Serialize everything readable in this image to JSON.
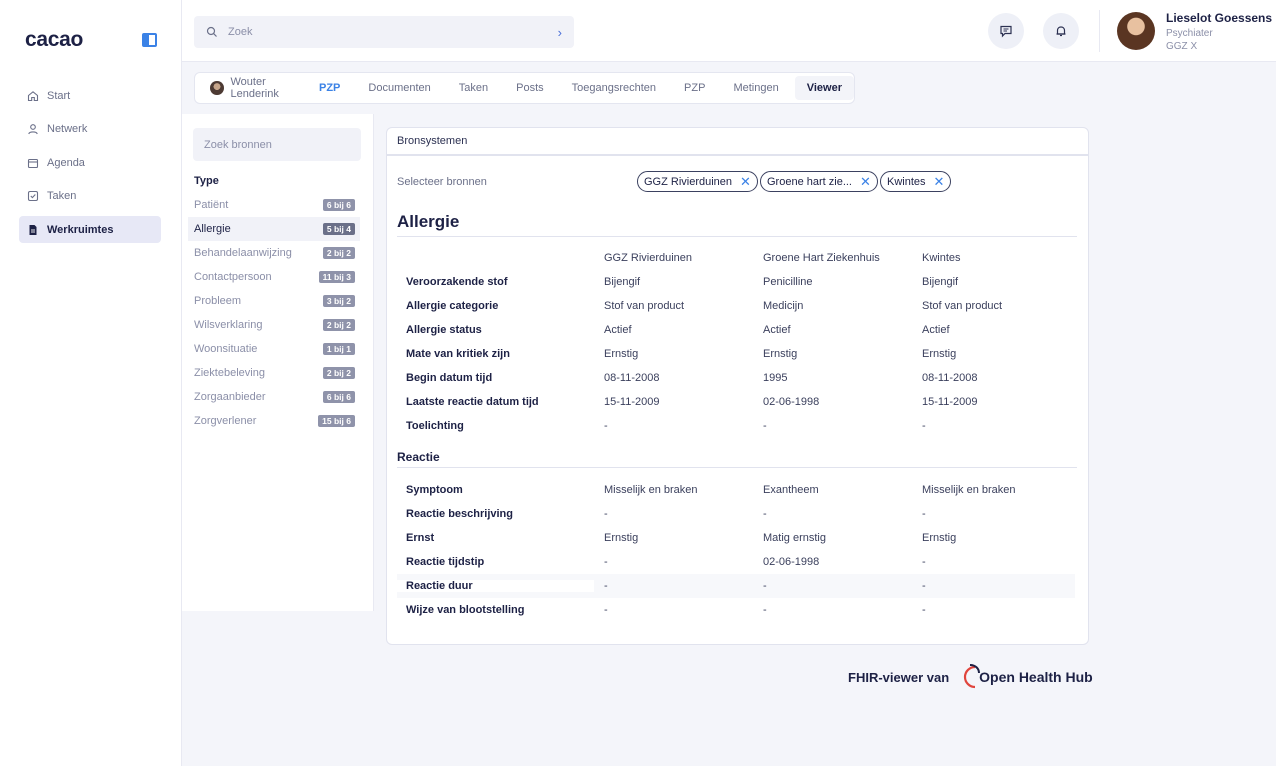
{
  "app": {
    "logo": "cacao"
  },
  "sidebar": {
    "items": [
      {
        "label": "Start",
        "icon": "home-icon"
      },
      {
        "label": "Netwerk",
        "icon": "user-icon"
      },
      {
        "label": "Agenda",
        "icon": "calendar-icon"
      },
      {
        "label": "Taken",
        "icon": "check-square-icon"
      },
      {
        "label": "Werkruimtes",
        "icon": "document-icon",
        "active": true
      }
    ]
  },
  "header": {
    "search_placeholder": "Zoek",
    "user": {
      "name": "Lieselot Goessens",
      "role": "Psychiater",
      "org": "GGZ X"
    }
  },
  "tabs": {
    "person": "Wouter Lenderink",
    "person_badge": "PZP",
    "items": [
      "Documenten",
      "Taken",
      "Posts",
      "Toegangsrechten",
      "PZP",
      "Metingen"
    ],
    "active": "Viewer"
  },
  "filter": {
    "search_placeholder": "Zoek bronnen",
    "type_heading": "Type",
    "types": [
      {
        "label": "Patiënt",
        "count": "6 bij 6"
      },
      {
        "label": "Allergie",
        "count": "5 bij 4",
        "active": true
      },
      {
        "label": "Behandelaanwijzing",
        "count": "2 bij 2"
      },
      {
        "label": "Contactpersoon",
        "count": "11 bij 3"
      },
      {
        "label": "Probleem",
        "count": "3 bij 2"
      },
      {
        "label": "Wilsverklaring",
        "count": "2 bij 2"
      },
      {
        "label": "Woonsituatie",
        "count": "1 bij 1"
      },
      {
        "label": "Ziektebeleving",
        "count": "2 bij 2"
      },
      {
        "label": "Zorgaanbieder",
        "count": "6 bij 6"
      },
      {
        "label": "Zorgverlener",
        "count": "15 bij 6"
      }
    ]
  },
  "viewer": {
    "card_title": "Bronsystemen",
    "select_label": "Selecteer bronnen",
    "chips": [
      "GGZ Rivierduinen",
      "Groene hart zie...",
      "Kwintes"
    ],
    "section_title": "Allergie",
    "columns": [
      "GGZ Rivierduinen",
      "Groene Hart Ziekenhuis",
      "Kwintes"
    ],
    "allergy_rows": [
      {
        "label": "Veroorzakende stof",
        "values": [
          "Bijengif",
          "Penicilline",
          "Bijengif"
        ]
      },
      {
        "label": "Allergie categorie",
        "values": [
          "Stof van product",
          "Medicijn",
          "Stof van product"
        ]
      },
      {
        "label": "Allergie status",
        "values": [
          "Actief",
          "Actief",
          "Actief"
        ]
      },
      {
        "label": "Mate van kritiek zijn",
        "values": [
          "Ernstig",
          "Ernstig",
          "Ernstig"
        ]
      },
      {
        "label": "Begin datum tijd",
        "values": [
          "08-11-2008",
          "1995",
          "08-11-2008"
        ]
      },
      {
        "label": "Laatste reactie datum tijd",
        "values": [
          "15-11-2009",
          "02-06-1998",
          "15-11-2009"
        ]
      },
      {
        "label": "Toelichting",
        "values": [
          "-",
          "-",
          "-"
        ]
      }
    ],
    "reaction_title": "Reactie",
    "reaction_rows": [
      {
        "label": "Symptoom",
        "values": [
          "Misselijk en braken",
          "Exantheem",
          "Misselijk en braken"
        ]
      },
      {
        "label": "Reactie beschrijving",
        "values": [
          "-",
          "-",
          "-"
        ]
      },
      {
        "label": "Ernst",
        "values": [
          "Ernstig",
          "Matig ernstig",
          "Ernstig"
        ]
      },
      {
        "label": "Reactie tijdstip",
        "values": [
          "-",
          "02-06-1998",
          "-"
        ]
      },
      {
        "label": "Reactie duur",
        "values": [
          "-",
          "-",
          "-"
        ]
      },
      {
        "label": "Wijze van blootstelling",
        "values": [
          "-",
          "-",
          "-"
        ]
      }
    ]
  },
  "footer": {
    "text": "FHIR-viewer van",
    "brand": "Open Health Hub"
  }
}
